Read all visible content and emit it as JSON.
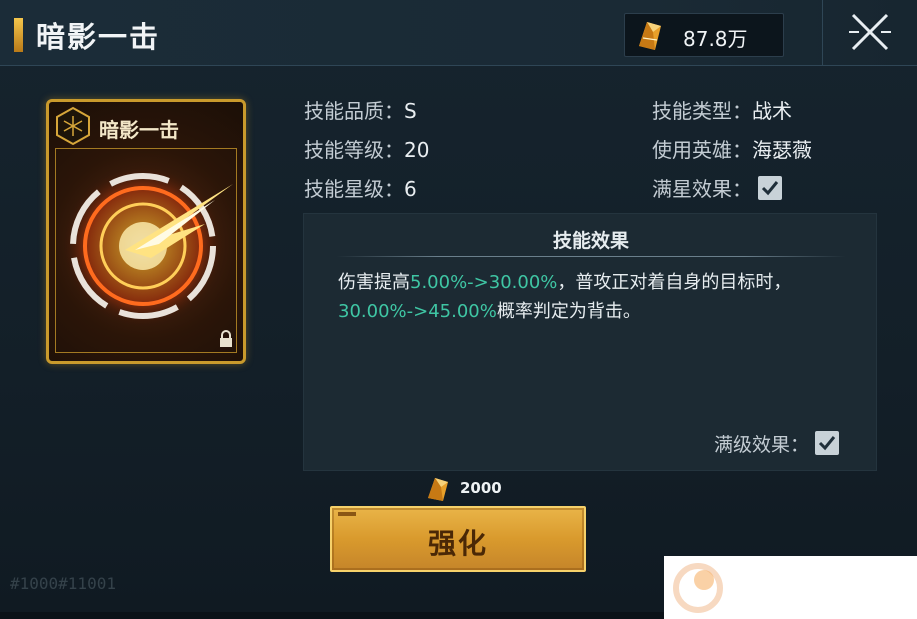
{
  "header": {
    "title": "暗影一击",
    "currency_value": "87.8万",
    "currency_icon": "crystal-icon",
    "close_icon": "close-icon"
  },
  "card": {
    "title": "暗影一击",
    "emblem_icon": "hexagon-emblem-icon",
    "lock_icon": "lock-icon"
  },
  "info": {
    "quality_label": "技能品质：",
    "quality_value": "S",
    "level_label": "技能等级：",
    "level_value": "20",
    "star_label": "技能星级：",
    "star_value": "6",
    "type_label": "技能类型：",
    "type_value": "战术",
    "hero_label": "使用英雄：",
    "hero_value": "海瑟薇",
    "fullstar_label": "满星效果：",
    "fullstar_checked": true
  },
  "effect": {
    "title": "技能效果",
    "line1_pre": "伤害提高",
    "line1_hl": "5.00%->30.00%",
    "line1_post": "，普攻正对着自身的目标时，",
    "line2_hl": "30.00%->45.00%",
    "line2_post": "概率判定为背击。",
    "maxlevel_label": "满级效果：",
    "maxlevel_checked": true
  },
  "upgrade": {
    "cost_value": "2000",
    "cost_icon": "crystal-icon",
    "button_label": "强化"
  },
  "footer": {
    "id_text": "#1000#11001"
  },
  "colors": {
    "highlight": "#3fc6a4",
    "gold": "#d99a2d",
    "panel": "#1c2a33"
  }
}
